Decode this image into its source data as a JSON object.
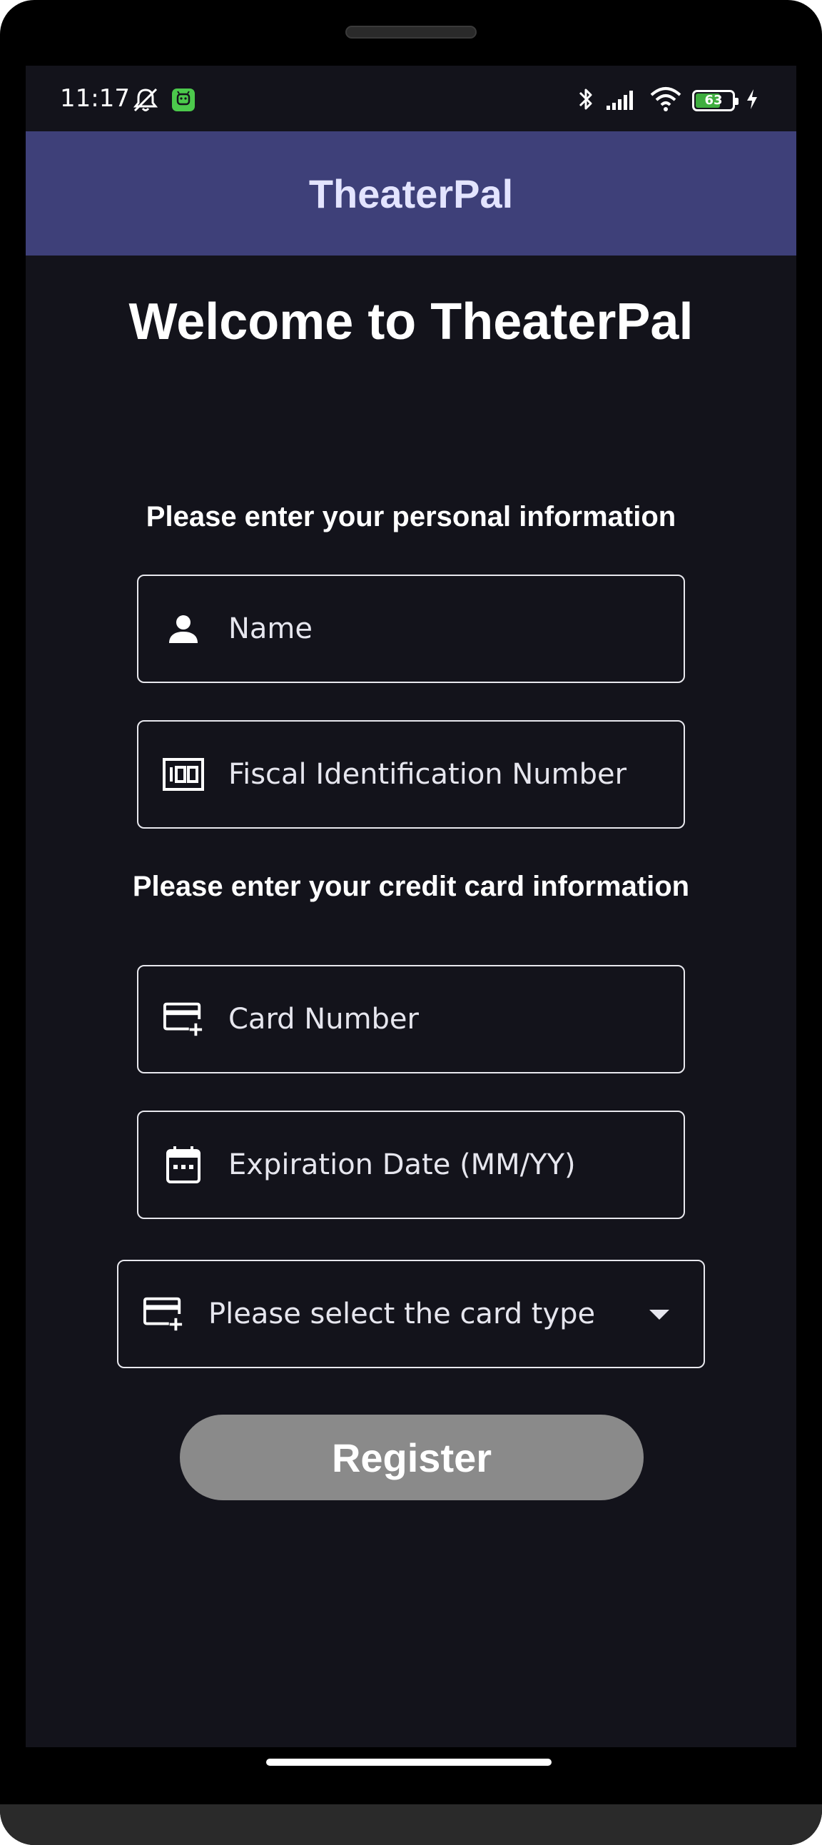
{
  "status_bar": {
    "time": "11:17",
    "battery_level": "63",
    "battery_fraction": 0.63,
    "icons": [
      "bell-off-icon",
      "android-app-icon",
      "bluetooth-icon",
      "signal-icon",
      "wifi-icon",
      "battery-icon",
      "charging-icon"
    ]
  },
  "app_bar": {
    "title": "TheaterPal"
  },
  "main": {
    "welcome": "Welcome to TheaterPal",
    "personal_heading": "Please enter your personal information",
    "name_placeholder": "Name",
    "fiscal_placeholder": "Fiscal Identification Number",
    "card_heading": "Please enter your credit card information",
    "card_number_placeholder": "Card Number",
    "expiration_placeholder": "Expiration Date (MM/YY)",
    "card_type_placeholder": "Please select the card type",
    "register_label": "Register"
  },
  "colors": {
    "background": "#13131b",
    "app_bar": "#3e4079",
    "app_title": "#e3e4ff",
    "register_button": "#8a8a8a",
    "battery_fill": "#3fae3f"
  }
}
